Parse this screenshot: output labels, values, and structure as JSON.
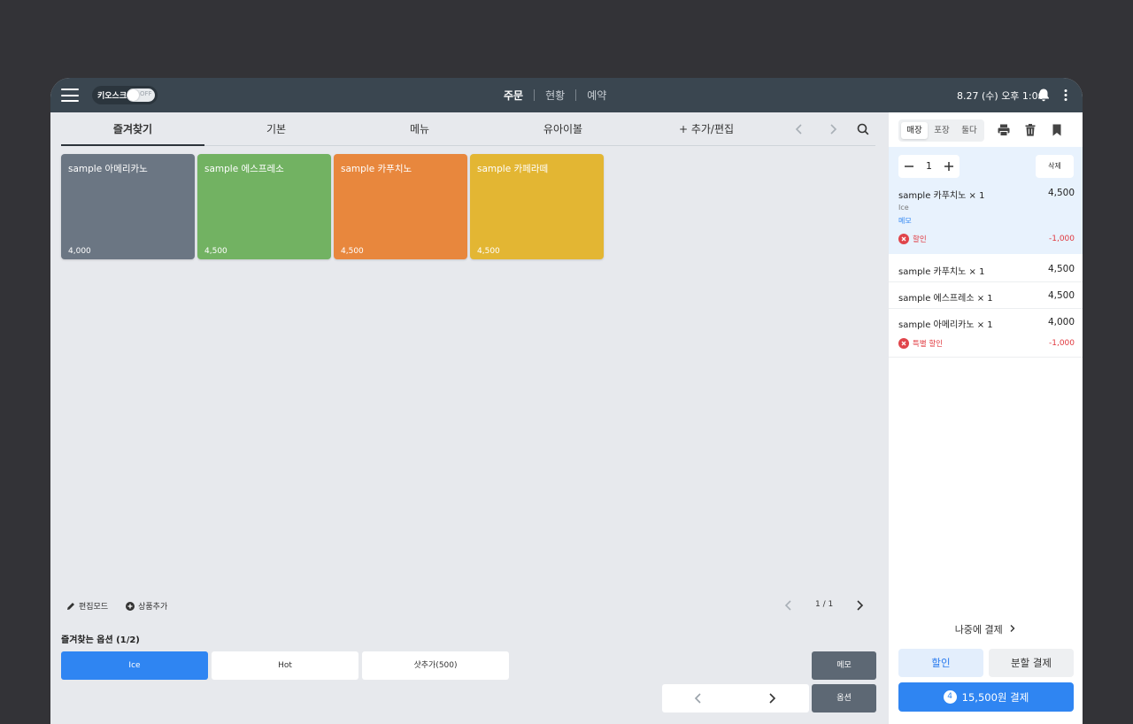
{
  "topbar": {
    "kiosk_label": "키오스크",
    "kiosk_state": "OFF",
    "nav": [
      "주문",
      "현황",
      "예약"
    ],
    "datetime": "8.27 (수) 오후 1:00"
  },
  "categories": {
    "tabs": [
      "즐겨찾기",
      "기본",
      "메뉴",
      "유아이볼",
      "+ 추가/편집"
    ]
  },
  "products": [
    {
      "name": "sample 아메리카노",
      "price": "4,000",
      "color": "#6b7683"
    },
    {
      "name": "sample 에스프레소",
      "price": "4,500",
      "color": "#72b262"
    },
    {
      "name": "sample 카푸치노",
      "price": "4,500",
      "color": "#e8873d"
    },
    {
      "name": "sample 카페라떼",
      "price": "4,500",
      "color": "#e3b633"
    }
  ],
  "toolbar": {
    "edit_mode": "편집모드",
    "add_product": "상품추가",
    "page": "1 / 1"
  },
  "options": {
    "title": "즐겨찾는 옵션 (1/2)",
    "items": [
      "Ice",
      "Hot",
      "샷추가(500)"
    ],
    "memo": "메모",
    "option": "옵션"
  },
  "order_panel": {
    "modes": [
      "매장",
      "포장",
      "둘다"
    ],
    "selected": {
      "qty": "1",
      "delete": "삭제",
      "name": "sample 카푸치노 × 1",
      "price": "4,500",
      "option": "Ice",
      "memo": "메모",
      "discount_label": "할인",
      "discount_amount": "-1,000"
    },
    "items": [
      {
        "name": "sample 카푸치노 × 1",
        "price": "4,500"
      },
      {
        "name": "sample 에스프레소 × 1",
        "price": "4,500"
      },
      {
        "name": "sample 아메리카노 × 1",
        "price": "4,000",
        "discount_label": "특별 할인",
        "discount_amount": "-1,000"
      }
    ],
    "pay_later": "나중에 결제",
    "discount_button": "할인",
    "split_button": "분할 결제",
    "pay_count": "4",
    "pay_button": "15,500원 결제"
  },
  "colors": {
    "accent": "#2f85f2",
    "danger": "#e0383e",
    "topbar": "#3a4650"
  }
}
